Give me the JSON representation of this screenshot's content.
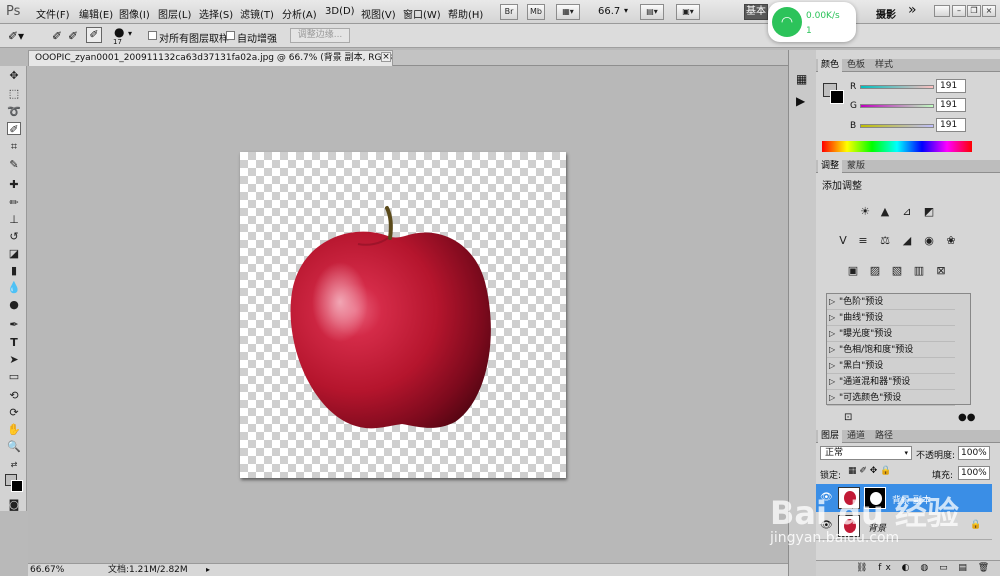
{
  "app": {
    "logo": "Ps"
  },
  "menubar": {
    "items": [
      "文件(F)",
      "编辑(E)",
      "图像(I)",
      "图层(L)",
      "选择(S)",
      "滤镜(T)",
      "分析(A)",
      "3D(D)",
      "视图(V)",
      "窗口(W)",
      "帮助(H)"
    ],
    "br_label": "Br",
    "mb_label": "Mb",
    "zoom": "66.7",
    "workspace": "基本",
    "workspace2": "摄影",
    "more": "»"
  },
  "optionsbar": {
    "brush_size": "17",
    "sample_all_layers": "对所有图层取样",
    "auto_enhance": "自动增强",
    "refine_edge": "调整边缘..."
  },
  "document": {
    "tab_title": "OOOPIC_zyan0001_200911132ca63d37131fa02a.jpg @ 66.7% (背景 副本, RGB/8#) *",
    "close": "×"
  },
  "status": {
    "zoom": "66.67%",
    "doc_info": "文档:1.21M/2.82M"
  },
  "network": {
    "speed": "0.00K/s",
    "count": "1"
  },
  "color_panel": {
    "tabs": [
      "颜色",
      "色板",
      "样式"
    ],
    "channels": [
      {
        "label": "R",
        "value": "191"
      },
      {
        "label": "G",
        "value": "191"
      },
      {
        "label": "B",
        "value": "191"
      }
    ]
  },
  "adjust_panel": {
    "tabs": [
      "调整",
      "蒙版"
    ],
    "title": "添加调整",
    "presets": [
      "\"色阶\"预设",
      "\"曲线\"预设",
      "\"曝光度\"预设",
      "\"色相/饱和度\"预设",
      "\"黑白\"预设",
      "\"通道混和器\"预设",
      "\"可选颜色\"预设"
    ]
  },
  "layers_panel": {
    "tabs": [
      "图层",
      "通道",
      "路径"
    ],
    "blend_mode": "正常",
    "opacity_label": "不透明度:",
    "opacity": "100%",
    "lock_label": "锁定:",
    "fill_label": "填充:",
    "fill": "100%",
    "layers": [
      {
        "name": "背景 副本",
        "selected": true
      },
      {
        "name": "背景",
        "selected": false
      }
    ]
  },
  "watermark": {
    "text": "Bai du 经验",
    "url": "jingyan.baidu.com"
  },
  "colors": {
    "selection": "#3a8ee6",
    "panel_bg": "#d6d6d6",
    "canvas_bg": "#b8b8b8"
  }
}
